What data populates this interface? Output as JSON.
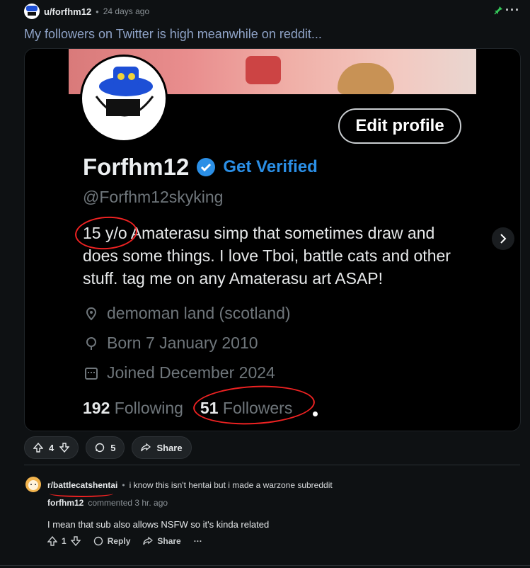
{
  "post": {
    "author": "u/forfhm12",
    "separator": "•",
    "time_ago": "24 days ago",
    "title": "My followers on Twitter is high meanwhile on reddit...",
    "pinned_icon": "pin-icon",
    "more_icon": "more-icon",
    "upvotes": "4",
    "comments": "5",
    "share_label": "Share"
  },
  "image": {
    "edit_profile": "Edit profile",
    "display_name": "Forfhm12",
    "get_verified": "Get Verified",
    "handle": "@Forfhm12skyking",
    "bio": "15 y/o Amaterasu simp that sometimes draw and does some things. I love Tboi, battle cats and other stuff. tag me on any Amaterasu art ASAP!",
    "location": "demoman land (scotland)",
    "born": "Born 7 January 2010",
    "joined": "Joined December 2024",
    "following_count": "192",
    "following_label": "Following",
    "followers_count": "51",
    "followers_label": "Followers"
  },
  "comment": {
    "subreddit": "r/battlecatshentai",
    "separator": "•",
    "flair_text": "i know this isn't hentai but i made a warzone subreddit",
    "author": "forfhm12",
    "meta": "commented 3 hr. ago",
    "body": "I mean that sub also allows NSFW so it's kinda related",
    "upvotes": "1",
    "reply_label": "Reply",
    "share_label": "Share",
    "more_label": "···"
  },
  "colors": {
    "accent_blue": "#2b8fe6",
    "annotation_red": "#e22",
    "pin_green": "#34c759"
  }
}
